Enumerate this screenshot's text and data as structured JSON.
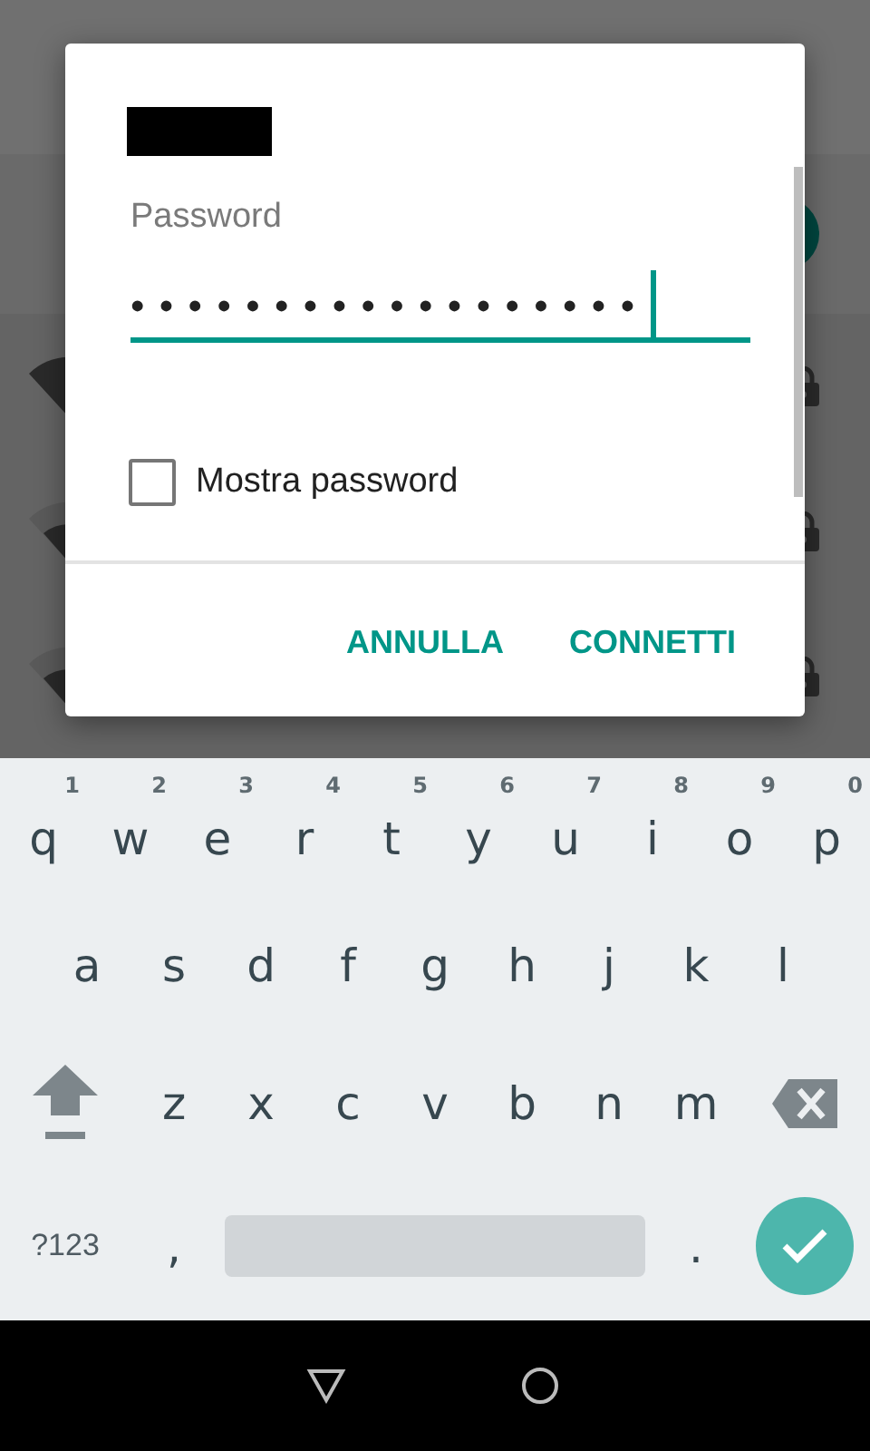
{
  "background": {
    "networks": [
      {
        "secured": true
      },
      {
        "secured": true
      },
      {
        "secured": true
      }
    ]
  },
  "dialog": {
    "field": {
      "label": "Password",
      "value": "••••••••••••••••••",
      "focused": true
    },
    "show_password": {
      "label": "Mostra password",
      "checked": false
    },
    "buttons": [
      "ANNULLA",
      "CONNETTI"
    ]
  },
  "keyboard": {
    "rows": [
      {
        "keys": [
          {
            "kind": "letter",
            "label": "q",
            "hint": "1"
          },
          {
            "kind": "letter",
            "label": "w",
            "hint": "2"
          },
          {
            "kind": "letter",
            "label": "e",
            "hint": "3"
          },
          {
            "kind": "letter",
            "label": "r",
            "hint": "4"
          },
          {
            "kind": "letter",
            "label": "t",
            "hint": "5"
          },
          {
            "kind": "letter",
            "label": "y",
            "hint": "6"
          },
          {
            "kind": "letter",
            "label": "u",
            "hint": "7"
          },
          {
            "kind": "letter",
            "label": "i",
            "hint": "8"
          },
          {
            "kind": "letter",
            "label": "o",
            "hint": "9"
          },
          {
            "kind": "letter",
            "label": "p",
            "hint": "0"
          }
        ]
      },
      {
        "keys": [
          {
            "kind": "letter",
            "label": "a"
          },
          {
            "kind": "letter",
            "label": "s"
          },
          {
            "kind": "letter",
            "label": "d"
          },
          {
            "kind": "letter",
            "label": "f"
          },
          {
            "kind": "letter",
            "label": "g"
          },
          {
            "kind": "letter",
            "label": "h"
          },
          {
            "kind": "letter",
            "label": "j"
          },
          {
            "kind": "letter",
            "label": "k"
          },
          {
            "kind": "letter",
            "label": "l"
          }
        ]
      },
      {
        "keys": [
          {
            "kind": "shift"
          },
          {
            "kind": "letter",
            "label": "z"
          },
          {
            "kind": "letter",
            "label": "x"
          },
          {
            "kind": "letter",
            "label": "c"
          },
          {
            "kind": "letter",
            "label": "v"
          },
          {
            "kind": "letter",
            "label": "b"
          },
          {
            "kind": "letter",
            "label": "n"
          },
          {
            "kind": "letter",
            "label": "m"
          },
          {
            "kind": "backspace"
          }
        ]
      },
      {
        "keys": [
          {
            "kind": "symbols",
            "label": "?123"
          },
          {
            "kind": "letter",
            "label": ","
          },
          {
            "kind": "space"
          },
          {
            "kind": "letter",
            "label": "."
          },
          {
            "kind": "enter"
          }
        ]
      }
    ]
  }
}
